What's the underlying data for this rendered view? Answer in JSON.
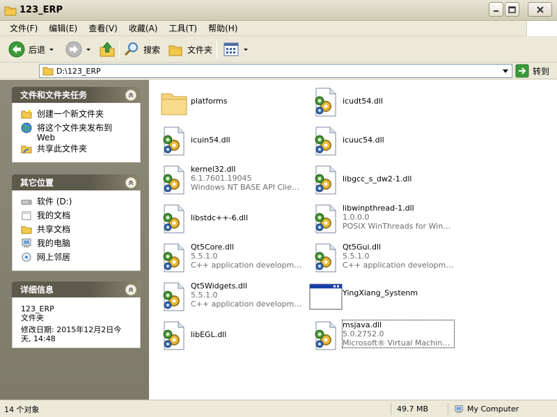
{
  "window": {
    "title": "123_ERP"
  },
  "menu": [
    "文件(F)",
    "编辑(E)",
    "查看(V)",
    "收藏(A)",
    "工具(T)",
    "帮助(H)"
  ],
  "toolbar": {
    "back": "后退",
    "search": "搜索",
    "folders": "文件夹"
  },
  "address": {
    "path": "D:\\123_ERP",
    "go": "转到"
  },
  "tasks": {
    "title": "文件和文件夹任务",
    "items": [
      {
        "label": "创建一个新文件夹",
        "icon": "new-folder-icon"
      },
      {
        "label": "将这个文件夹发布到",
        "label2": "Web",
        "icon": "publish-web-icon"
      },
      {
        "label": "共享此文件夹",
        "icon": "share-folder-icon"
      }
    ]
  },
  "places": {
    "title": "其它位置",
    "items": [
      {
        "label": "软件 (D:)",
        "icon": "drive-icon"
      },
      {
        "label": "我的文档",
        "icon": "my-documents-icon"
      },
      {
        "label": "共享文档",
        "icon": "shared-documents-icon"
      },
      {
        "label": "我的电脑",
        "icon": "my-computer-icon"
      },
      {
        "label": "网上邻居",
        "icon": "network-icon"
      }
    ]
  },
  "details": {
    "title": "详细信息",
    "name": "123_ERP",
    "type": "文件夹",
    "modified_line1": "修改日期: 2015年12月2日今",
    "modified_line2": "天, 14:48"
  },
  "files": [
    {
      "name": "platforms",
      "kind": "folder"
    },
    {
      "name": "icudt54.dll",
      "kind": "dll"
    },
    {
      "name": "icuin54.dll",
      "kind": "dll"
    },
    {
      "name": "icuuc54.dll",
      "kind": "dll"
    },
    {
      "name": "kernel32.dll",
      "kind": "dll",
      "version": "6.1.7601.19045",
      "desc": "Windows NT BASE API Client DLL"
    },
    {
      "name": "libgcc_s_dw2-1.dll",
      "kind": "dll"
    },
    {
      "name": "libstdc++-6.dll",
      "kind": "dll"
    },
    {
      "name": "libwinpthread-1.dll",
      "kind": "dll",
      "version": "1.0.0.0",
      "desc": "POSIX WinThreads for Windows"
    },
    {
      "name": "Qt5Core.dll",
      "kind": "dll",
      "version": "5.5.1.0",
      "desc": "C++ application development ..."
    },
    {
      "name": "Qt5Gui.dll",
      "kind": "dll",
      "version": "5.5.1.0",
      "desc": "C++ application development ..."
    },
    {
      "name": "Qt5Widgets.dll",
      "kind": "dll",
      "version": "5.5.1.0",
      "desc": "C++ application development ..."
    },
    {
      "name": "YingXiang_Systenm",
      "kind": "exe"
    },
    {
      "name": "libEGL.dll",
      "kind": "dll"
    },
    {
      "name": "msjava.dll",
      "kind": "dll",
      "version": "5.0.2752.0",
      "desc": "Microsoft® Virtual Machine for...",
      "selected": true
    }
  ],
  "status": {
    "count": "14 个对象",
    "size": "49.7 MB",
    "location": "My Computer"
  }
}
